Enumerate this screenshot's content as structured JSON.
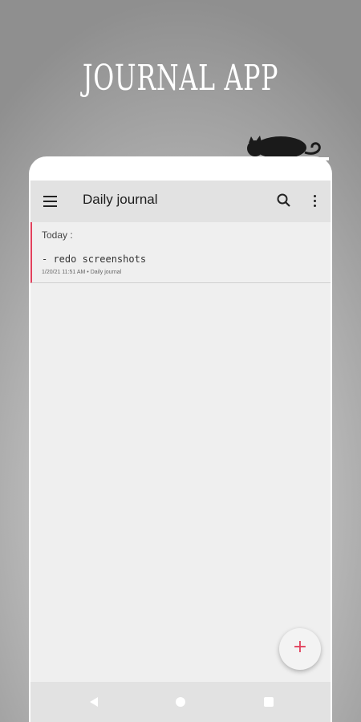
{
  "promo": {
    "title": "JOURNAL APP"
  },
  "toolbar": {
    "title": "Daily journal"
  },
  "section": {
    "label": "Today :"
  },
  "entries": [
    {
      "text": "- redo screenshots",
      "meta": "1/20/21 11:51 AM • Daily journal"
    }
  ],
  "fab": {
    "label": "+"
  },
  "colors": {
    "accent": "#e2405c",
    "toolbar": "#e2e2e2",
    "background": "#efefef"
  },
  "icons": {
    "menu": "hamburger-menu-icon",
    "search": "search-icon",
    "more": "more-vert-icon",
    "back": "nav-back-icon",
    "home": "nav-home-icon",
    "recent": "nav-recent-icon",
    "cat": "sleeping-cat-icon"
  }
}
